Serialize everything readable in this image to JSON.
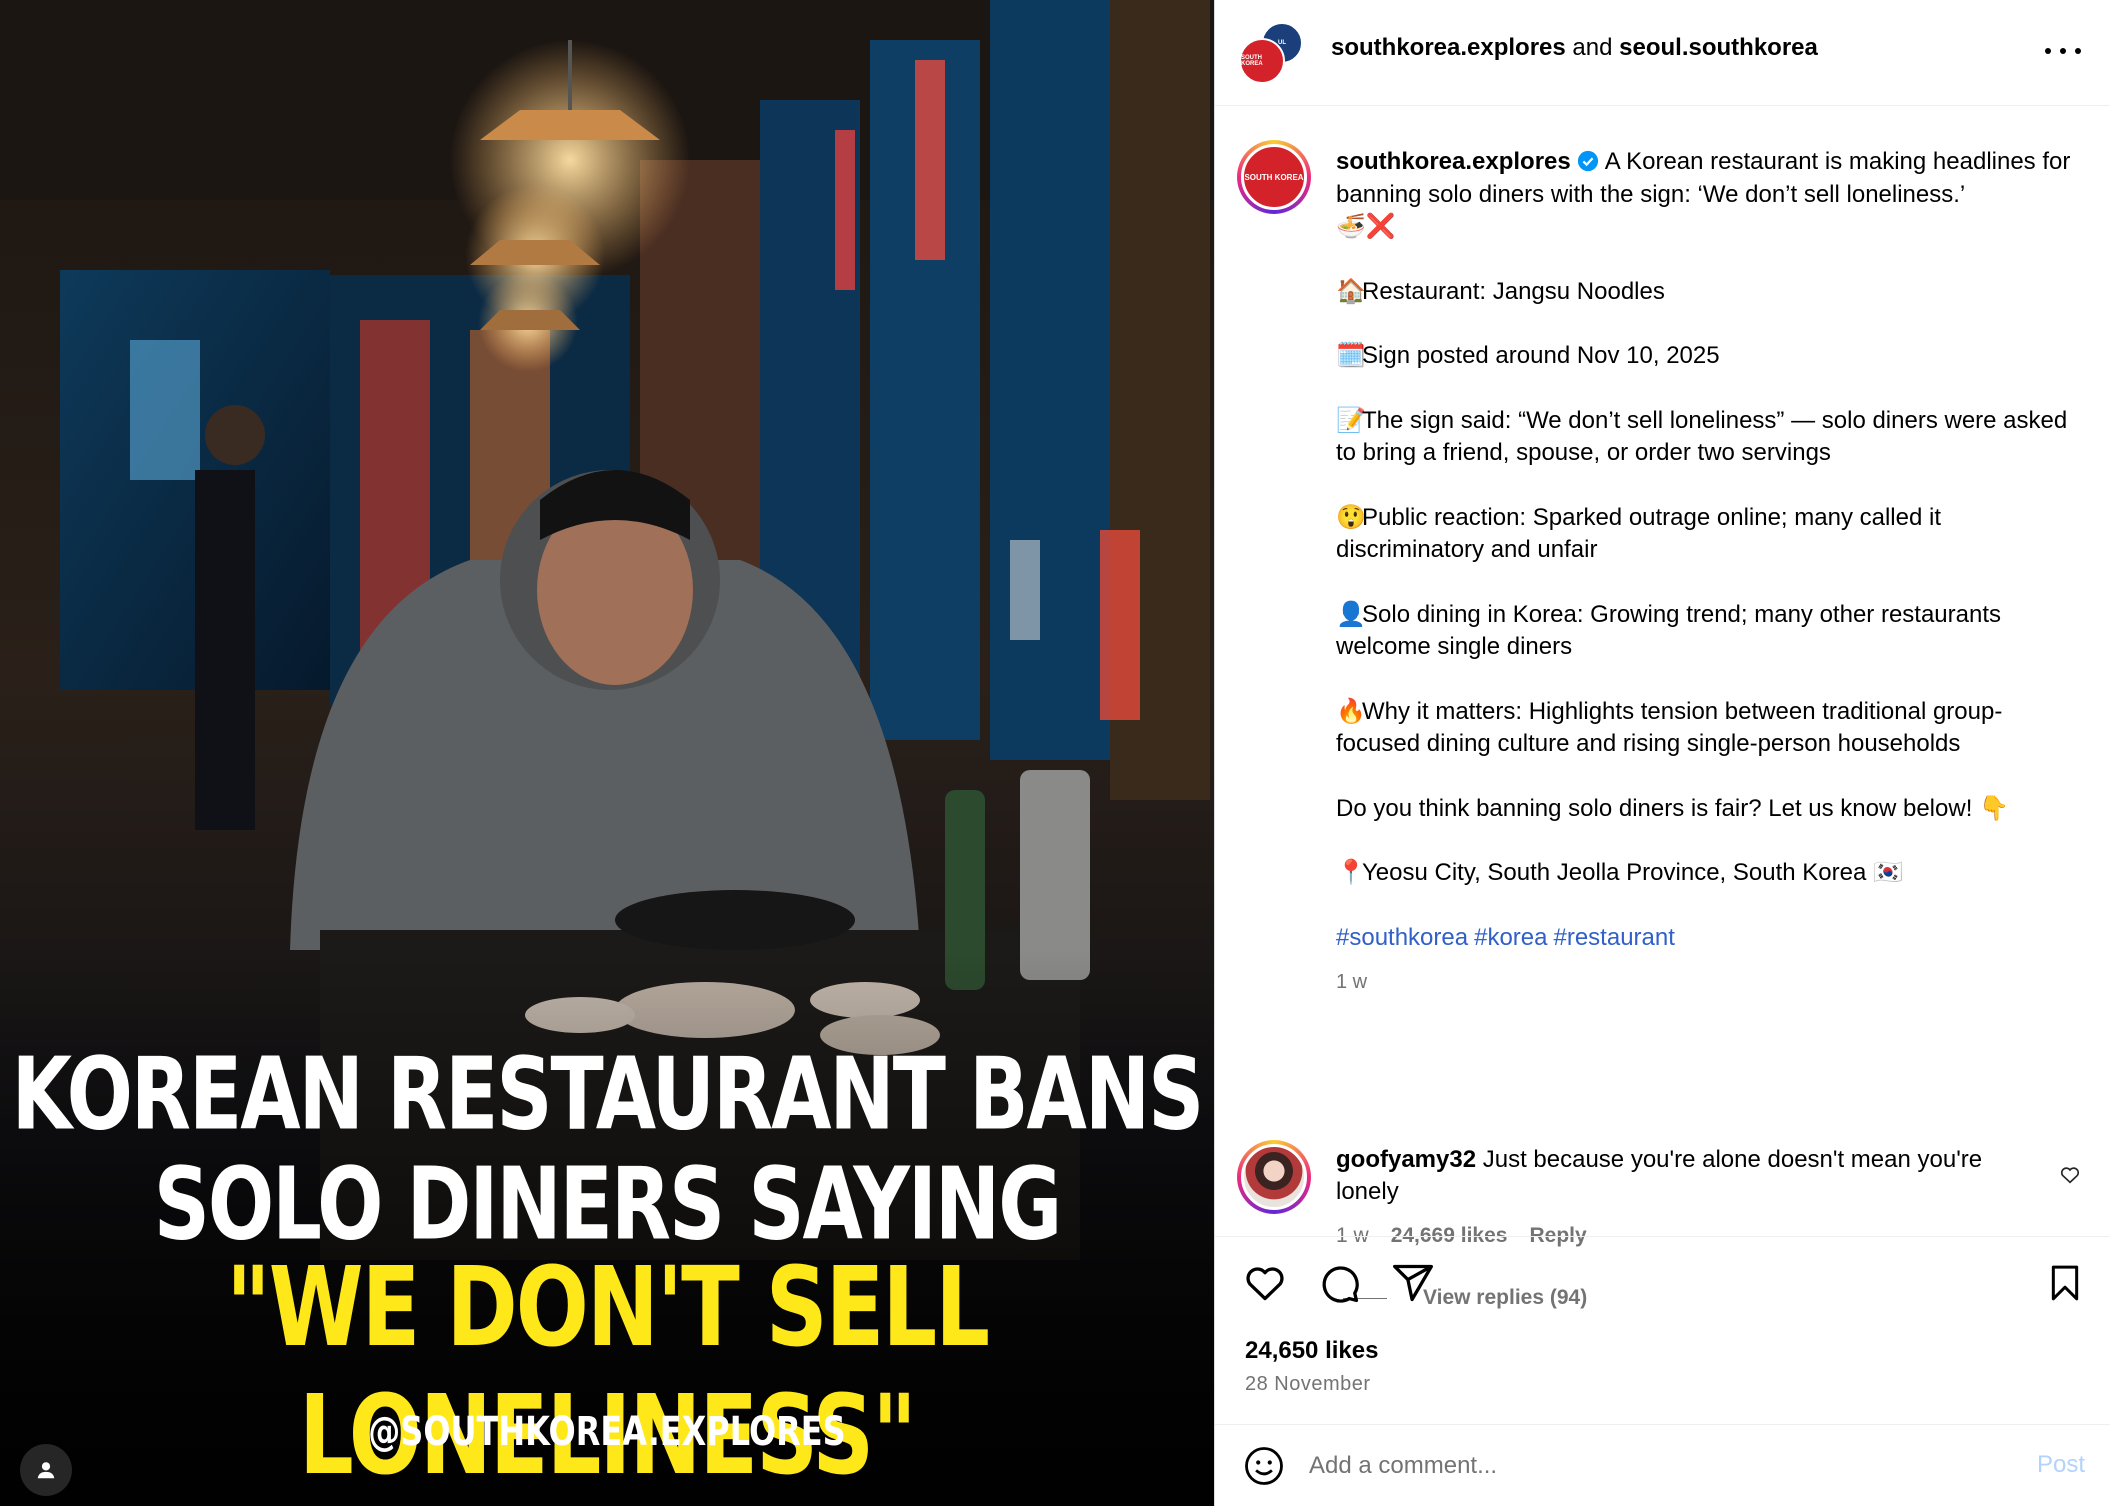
{
  "media": {
    "headline_line1": "KOREAN RESTAURANT BANS",
    "headline_line2": "SOLO DINERS SAYING",
    "headline_line3": "\"WE DON'T SELL LONELINESS\"",
    "watermark": "@SOUTHKOREA.EXPLORES",
    "tag_icon": "user-icon"
  },
  "header": {
    "author1": "southkorea.explores",
    "connector": " and ",
    "author2": "seoul.southkorea",
    "avatar_front_text": "SOUTH KOREA",
    "more_icon": "more-horizontal-icon"
  },
  "caption": {
    "username": "southkorea.explores",
    "intro": "A Korean restaurant is making headlines for banning solo diners with the sign: ‘We don’t sell loneliness.’",
    "intro_emoji": "🍜❌",
    "restaurant_emoji": "🏠",
    "restaurant": "Restaurant: Jangsu Noodles",
    "date_emoji": "🗓️",
    "date_line": "Sign posted around Nov 10, 2025",
    "sign_emoji": "📝",
    "sign_line": "The sign said: “We don’t sell loneliness” — solo diners were asked to bring a friend, spouse, or order two servings",
    "reaction_emoji": "😲",
    "reaction_line": "Public reaction: Sparked outrage online; many called it discriminatory and unfair",
    "solo_emoji": "👤",
    "solo_line": "Solo dining in Korea: Growing trend; many other restaurants welcome single diners",
    "matters_emoji": "🔥",
    "matters_line": "Why it matters: Highlights tension between traditional group-focused dining culture and rising single-person households",
    "question": "Do you think banning solo diners is fair? Let us know below!",
    "question_emoji": "👇",
    "location_emoji": "📍",
    "location": "Yeosu City, South Jeolla Province, South Korea",
    "location_flag": "🇰🇷",
    "hashtags": [
      "#southkorea",
      "#korea",
      "#restaurant"
    ],
    "time": "1 w"
  },
  "comment": {
    "username": "goofyamy32",
    "text": "Just because you're alone doesn't mean you're lonely",
    "time": "1 w",
    "likes": "24,669 likes",
    "reply": "Reply",
    "view_replies": "View replies (94)"
  },
  "actions": {
    "likes": "24,650 likes",
    "date": "28 November"
  },
  "add_comment": {
    "placeholder": "Add a comment...",
    "post": "Post"
  },
  "colors": {
    "headline_yellow": "#ffe81a",
    "link_blue": "#3060c8",
    "brand_red": "#d4222a",
    "post_disabled": "#b3d3fb"
  }
}
